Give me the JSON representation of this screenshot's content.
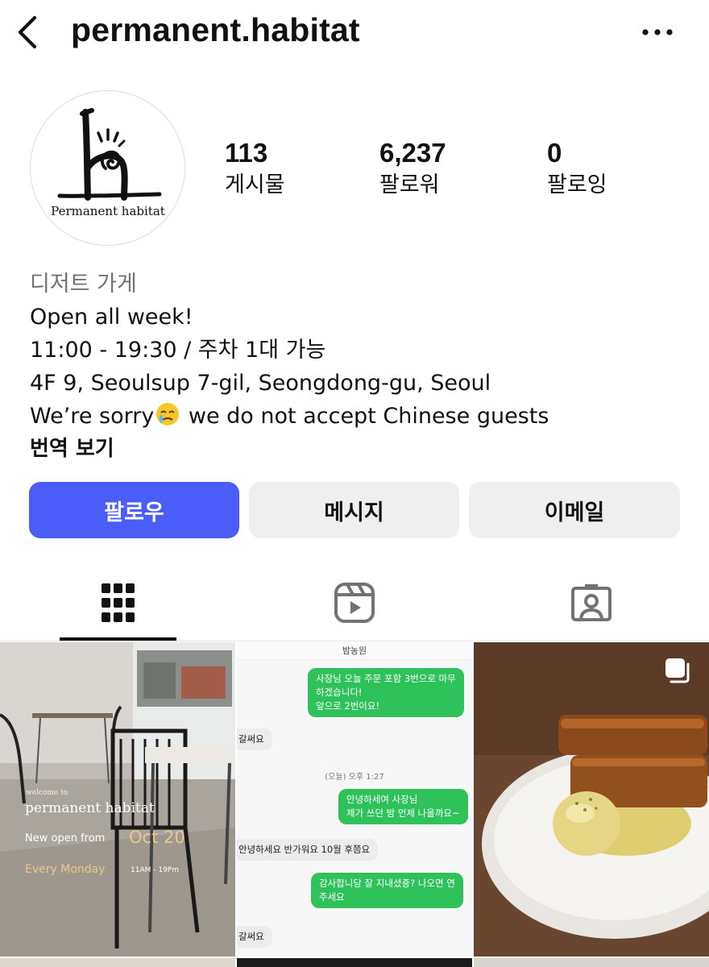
{
  "header": {
    "username": "permanent.habitat",
    "back_icon": "chevron-left-icon",
    "more_icon": "more-horizontal-icon"
  },
  "profile": {
    "avatar_text": "Permanent habitat",
    "stats": [
      {
        "value": "113",
        "label": "게시물"
      },
      {
        "value": "6,237",
        "label": "팔로워"
      },
      {
        "value": "0",
        "label": "팔로잉"
      }
    ]
  },
  "bio": {
    "category": "디저트 가게",
    "line1": "Open all week!",
    "line2": "11:00 - 19:30 / 주차 1대 가능",
    "line3": "4F 9, Seoulsup 7-gil, Seongdong-gu, Seoul",
    "line4_pre": "We’re sorry",
    "line4_post": " we do not accept Chinese guests",
    "translate": "번역 보기"
  },
  "actions": {
    "follow": "팔로우",
    "message": "메시지",
    "email": "이메일"
  },
  "tabs": [
    "grid-icon",
    "reels-icon",
    "tagged-icon"
  ],
  "colors": {
    "accent": "#4a5df9",
    "secondary_button": "#efefef",
    "muted_text": "#737373",
    "chat_green": "#2fc25b"
  },
  "posts": {
    "post1": {
      "welcome": "welcome to",
      "name": "permanent habitat",
      "open_prefix": "New open from",
      "open_date": "Oct 20",
      "closed": "Every Monday",
      "hours": "11AM  -  19Pm"
    },
    "post2": {
      "header": "밤농원",
      "msg1": "사장님 오늘 주문 포함 3번으로 마무\n하겠습니다!\n앞으로 2번이요!",
      "msg2": "갈써요",
      "time": "(오늘) 오후 1:27",
      "msg3": "안녕하세여 사장님\n제가 쓰던 밤 언제 나올까요~",
      "msg4": "안녕하세요 반가워요 10월 후쯤요",
      "msg5": "감사합니당 잘 지내셨죵? 나오면 연\n주세요",
      "msg6": "갈써요"
    }
  }
}
